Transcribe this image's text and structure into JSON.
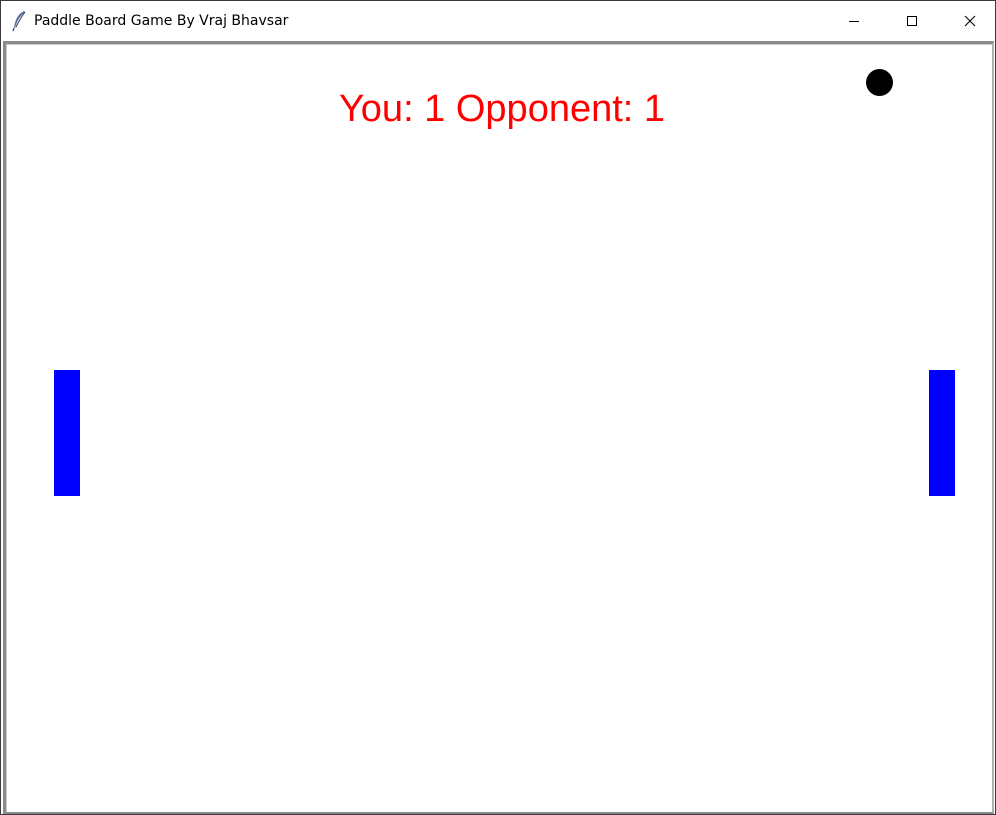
{
  "window": {
    "title": "Paddle Board Game By Vraj Bhavsar",
    "app_icon": "feather-icon",
    "controls": {
      "minimize_icon": "minimize-icon",
      "maximize_icon": "maximize-icon",
      "close_icon": "close-icon"
    }
  },
  "game": {
    "score_text": "You: 1 Opponent: 1",
    "score": {
      "you": 1,
      "opponent": 1
    },
    "colors": {
      "score": "#ff0000",
      "paddle": "#0000ff",
      "ball": "#000000",
      "background": "#ffffff"
    }
  }
}
